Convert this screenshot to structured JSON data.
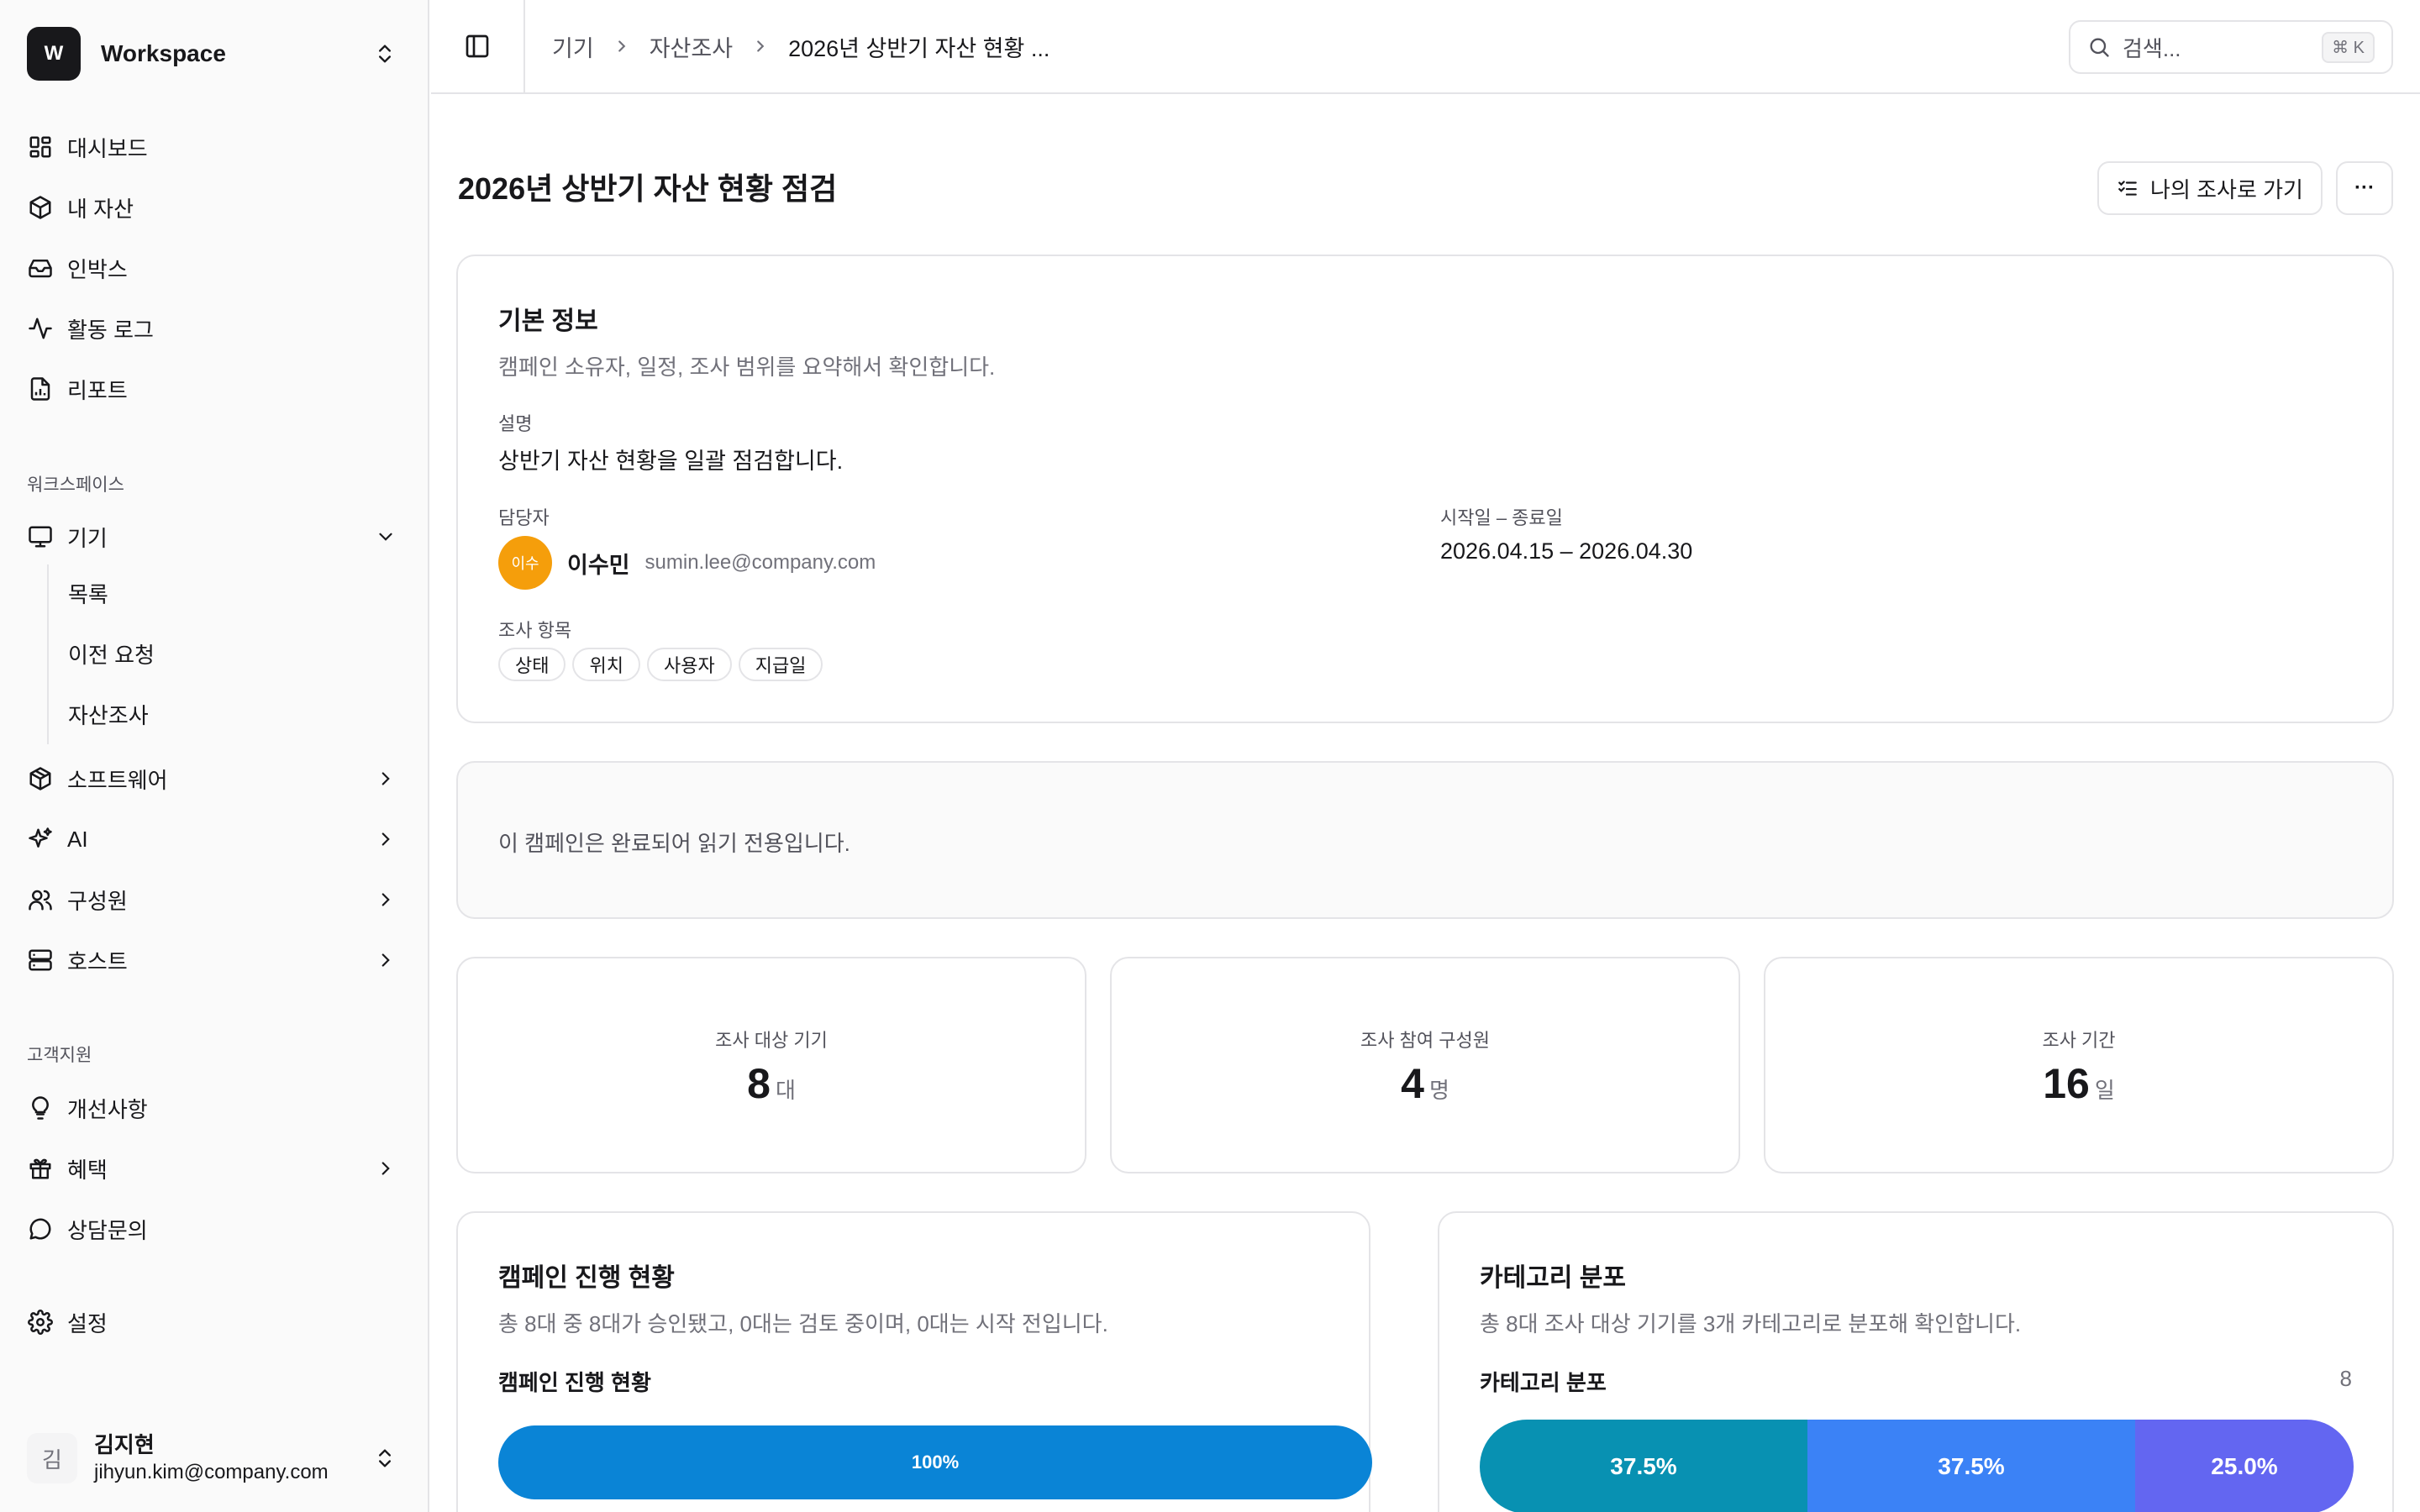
{
  "workspace": {
    "initial": "W",
    "name": "Workspace"
  },
  "nav": {
    "main": [
      {
        "label": "대시보드",
        "icon": "dashboard-icon"
      },
      {
        "label": "내 자산",
        "icon": "box-icon"
      },
      {
        "label": "인박스",
        "icon": "inbox-icon"
      },
      {
        "label": "활동 로그",
        "icon": "activity-icon"
      },
      {
        "label": "리포트",
        "icon": "report-icon"
      }
    ],
    "section_workspace": "워크스페이스",
    "devices": {
      "label": "기기",
      "sub": [
        "목록",
        "이전 요청",
        "자산조사"
      ]
    },
    "software": "소프트웨어",
    "ai": "AI",
    "members": "구성원",
    "hosts": "호스트",
    "section_support": "고객지원",
    "improvements": "개선사항",
    "benefits": "혜택",
    "consult": "상담문의",
    "settings": "설정"
  },
  "user": {
    "initial": "김",
    "name": "김지현",
    "email": "jihyun.kim@company.com"
  },
  "breadcrumb": [
    "기기",
    "자산조사",
    "2026년 상반기 자산 현황 ..."
  ],
  "search": {
    "placeholder": "검색...",
    "shortcut": "⌘ K"
  },
  "page": {
    "title": "2026년 상반기 자산 현황 점검",
    "my_survey_button": "나의 조사로 가기",
    "more": "···"
  },
  "basic_info": {
    "title": "기본 정보",
    "subtitle": "캠페인 소유자, 일정, 조사 범위를 요약해서 확인합니다.",
    "desc_label": "설명",
    "desc": "상반기 자산 현황을 일괄 점검합니다.",
    "owner_label": "담당자",
    "owner_avatar": "이수",
    "owner_name": "이수민",
    "owner_email": "sumin.lee@company.com",
    "period_label": "시작일 – 종료일",
    "period": "2026.04.15 – 2026.04.30",
    "items_label": "조사 항목",
    "items": [
      "상태",
      "위치",
      "사용자",
      "지급일"
    ]
  },
  "notice": "이 캠페인은 완료되어 읽기 전용입니다.",
  "stats": [
    {
      "label": "조사 대상 기기",
      "value": "8",
      "unit": "대"
    },
    {
      "label": "조사 참여 구성원",
      "value": "4",
      "unit": "명"
    },
    {
      "label": "조사 기간",
      "value": "16",
      "unit": "일"
    }
  ],
  "progress": {
    "title": "캠페인 진행 현황",
    "subtitle": "총 8대 중 8대가 승인됐고, 0대는 검토 중이며, 0대는 시작 전입니다.",
    "bar_label": "캠페인 진행 현황",
    "percent": 100,
    "percent_text": "100%",
    "color": "#0a84d6"
  },
  "category": {
    "title": "카테고리 분포",
    "subtitle": "총 8대 조사 대상 기기를 3개 카테고리로 분포해 확인합니다.",
    "bar_label": "카테고리 분포",
    "total": "8",
    "segments": [
      {
        "pct": 37.5,
        "text": "37.5%",
        "color": "#0891b2"
      },
      {
        "pct": 37.5,
        "text": "37.5%",
        "color": "#3b82f6"
      },
      {
        "pct": 25.0,
        "text": "25.0%",
        "color": "#6366f1"
      }
    ]
  },
  "colors": {
    "owner_avatar": "#f59e0b",
    "workspace_logo": "#18181b"
  }
}
